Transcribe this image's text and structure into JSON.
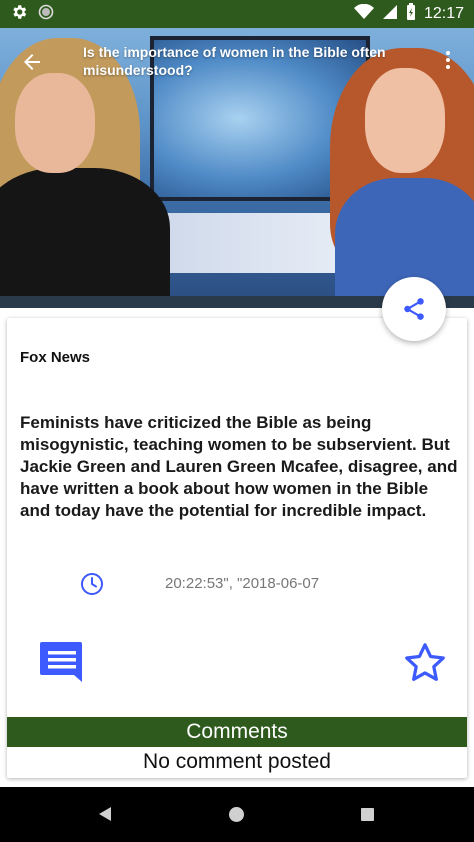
{
  "status_bar": {
    "time": "12:17",
    "icons": [
      "settings-icon",
      "circle-icon",
      "wifi-icon",
      "signal-icon",
      "battery-icon"
    ]
  },
  "app_bar": {
    "title": "Is the importance of women in the Bible often misunderstood?",
    "back_icon": "arrow-back-icon",
    "overflow_icon": "more-vert-icon"
  },
  "article": {
    "source": "Fox News",
    "description": "Feminists have criticized the Bible as being misogynistic, teaching women to be subservient. But Jackie Green and Lauren Green Mcafee, disagree, and have written a book about how women in the Bible and today have the potential for incredible impact.",
    "datetime": "20:22:53\", \"2018-06-07"
  },
  "actions": {
    "share_icon": "share-icon",
    "comment_icon": "comment-icon",
    "favorite_icon": "star-outline-icon"
  },
  "comments": {
    "header": "Comments",
    "empty_text": "No comment posted"
  },
  "colors": {
    "primary_dark": "#2f5a1d",
    "accent": "#3d5afe"
  }
}
